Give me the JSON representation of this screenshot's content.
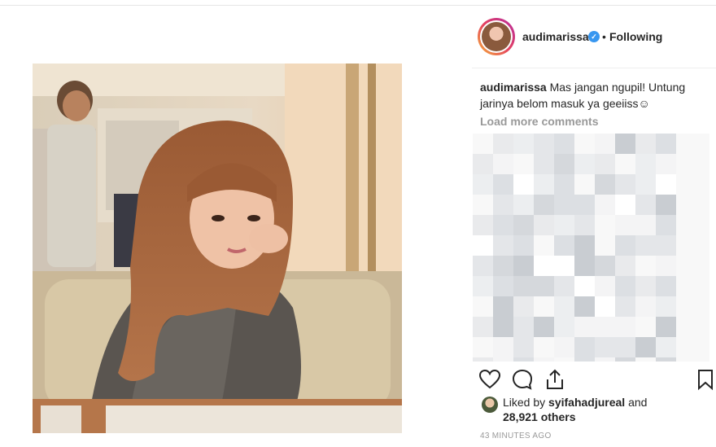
{
  "post": {
    "username": "audimarissa",
    "verified_badge": "✓",
    "separator": "•",
    "follow_label": "Following",
    "caption_user": "audimarissa",
    "caption_text": "Mas jangan ngupil! Untung jarinya belom masuk ya geeiiss☺",
    "load_more": "Load more comments",
    "liked_by_prefix": "Liked by",
    "liked_by_user": "syifahadjureal",
    "liked_by_and": "and",
    "liked_count": "28,921 others",
    "timestamp": "43 MINUTES AGO"
  },
  "icons": {
    "like": "heart-icon",
    "comment": "comment-icon",
    "share": "share-icon",
    "save": "bookmark-icon",
    "verified": "verified-badge-icon"
  },
  "colors": {
    "text": "#262626",
    "muted": "#999999",
    "verified": "#3897f0",
    "divider": "#efefef"
  }
}
